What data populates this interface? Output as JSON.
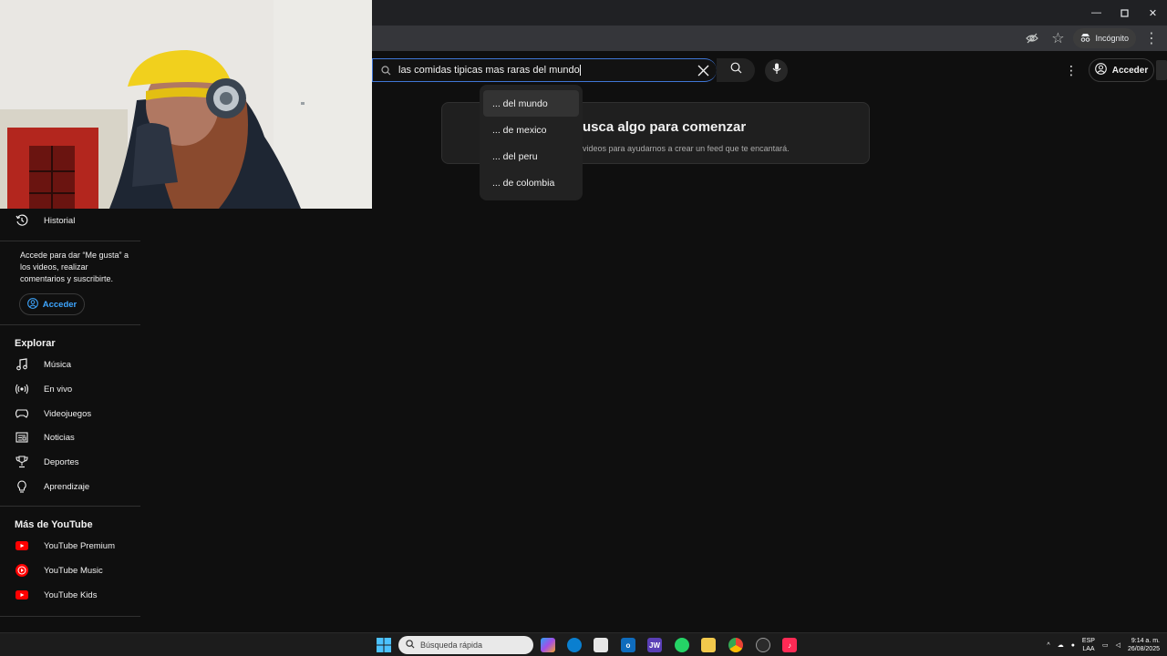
{
  "browser": {
    "incognito_label": "Incógnito"
  },
  "header": {
    "search_query_a": "las c",
    "search_query_b": "omidas tipicas mas raras del mundo",
    "signin_label": "Acceder"
  },
  "suggestions": [
    "... del mundo",
    "... de mexico",
    "... del peru",
    "... de colombia"
  ],
  "main": {
    "empty_title": "usca algo para comenzar",
    "empty_subtitle": "videos para ayudarnos a crear un feed que te encantará."
  },
  "sidebar": {
    "history_label": "Historial",
    "promo_text": "Accede para dar “Me gusta” a los videos, realizar comentarios y suscribirte.",
    "signin_label": "Acceder",
    "explore_heading": "Explorar",
    "explore_items": [
      "Música",
      "En vivo",
      "Videojuegos",
      "Noticias",
      "Deportes",
      "Aprendizaje"
    ],
    "more_heading": "Más de YouTube",
    "more_items": [
      "YouTube Premium",
      "YouTube Music",
      "YouTube Kids"
    ],
    "brand_red": "#ff0000"
  },
  "taskbar": {
    "search_placeholder": "Búsqueda rápida",
    "lang_top": "ESP",
    "lang_bottom": "LAA",
    "time": "9:14 a. m.",
    "date": "26/08/2025"
  }
}
